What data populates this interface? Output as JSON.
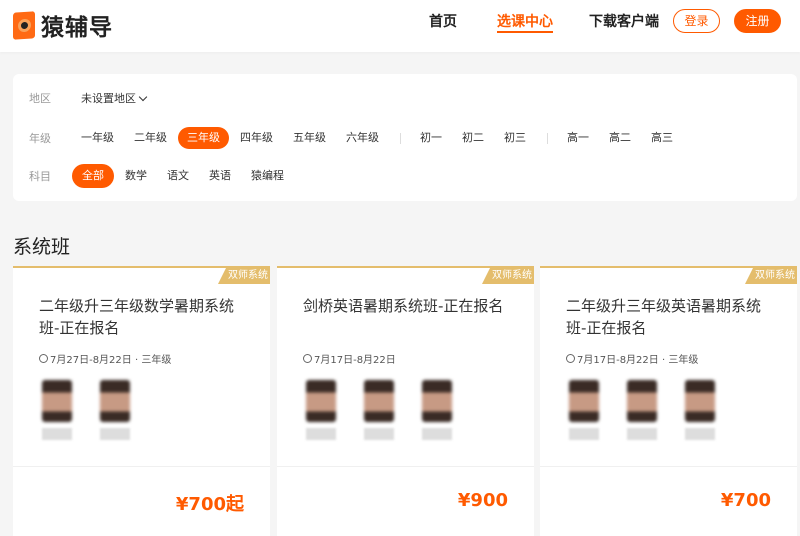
{
  "header": {
    "logo": "猿辅导",
    "nav": [
      "首页",
      "选课中心",
      "下载客户端"
    ],
    "login": "登录",
    "register": "注册"
  },
  "filter": {
    "region_label": "地区",
    "region_value": "未设置地区",
    "grade_label": "年级",
    "grades_primary": [
      "一年级",
      "二年级",
      "三年级",
      "四年级",
      "五年级",
      "六年级"
    ],
    "grades_middle": [
      "初一",
      "初二",
      "初三"
    ],
    "grades_high": [
      "高一",
      "高二",
      "高三"
    ],
    "subject_label": "科目",
    "subjects": [
      "全部",
      "数学",
      "语文",
      "英语",
      "猿编程"
    ]
  },
  "section_title": "系统班",
  "courses": [
    {
      "tag": "双师系统",
      "title": "二年级升三年级数学暑期系统班-正在报名",
      "meta": "7月27日-8月22日 · 三年级",
      "teachers": 2,
      "price": "¥700起"
    },
    {
      "tag": "双师系统",
      "title": "剑桥英语暑期系统班-正在报名",
      "meta": "7月17日-8月22日",
      "teachers": 3,
      "price": "¥900"
    },
    {
      "tag": "双师系统",
      "title": "二年级升三年级英语暑期系统班-正在报名",
      "meta": "7月17日-8月22日 · 三年级",
      "teachers": 3,
      "price": "¥700"
    }
  ],
  "colors": {
    "accent": "#ff5a00",
    "gold": "#e4bd6c"
  }
}
